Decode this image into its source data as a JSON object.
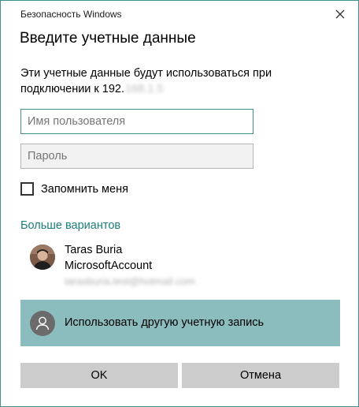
{
  "window": {
    "title": "Безопасность Windows"
  },
  "dialog": {
    "heading": "Введите учетные данные",
    "description": "Эти учетные данные будут использоваться при подключении к 192.",
    "ip_hidden": "168.1.5"
  },
  "fields": {
    "username_placeholder": "Имя пользователя",
    "password_placeholder": "Пароль"
  },
  "remember": {
    "label": "Запомнить меня",
    "checked": false
  },
  "more_options": {
    "label": "Больше вариантов"
  },
  "account": {
    "name": "Taras Buria",
    "type": "MicrosoftAccount",
    "email_hidden": "tarasburia.test@hotmail.com"
  },
  "other_account": {
    "label": "Использовать другую учетную запись"
  },
  "buttons": {
    "ok": "OK",
    "cancel": "Отмена"
  },
  "colors": {
    "accent": "#3f8f8d",
    "link": "#1b7d7a",
    "selected_row": "#8bbdbe",
    "button_bg": "#cccccc"
  },
  "icons": {
    "close": "close-icon",
    "checkbox": "checkbox-icon",
    "user_avatar": "user-avatar-photo",
    "generic_user": "person-icon"
  }
}
